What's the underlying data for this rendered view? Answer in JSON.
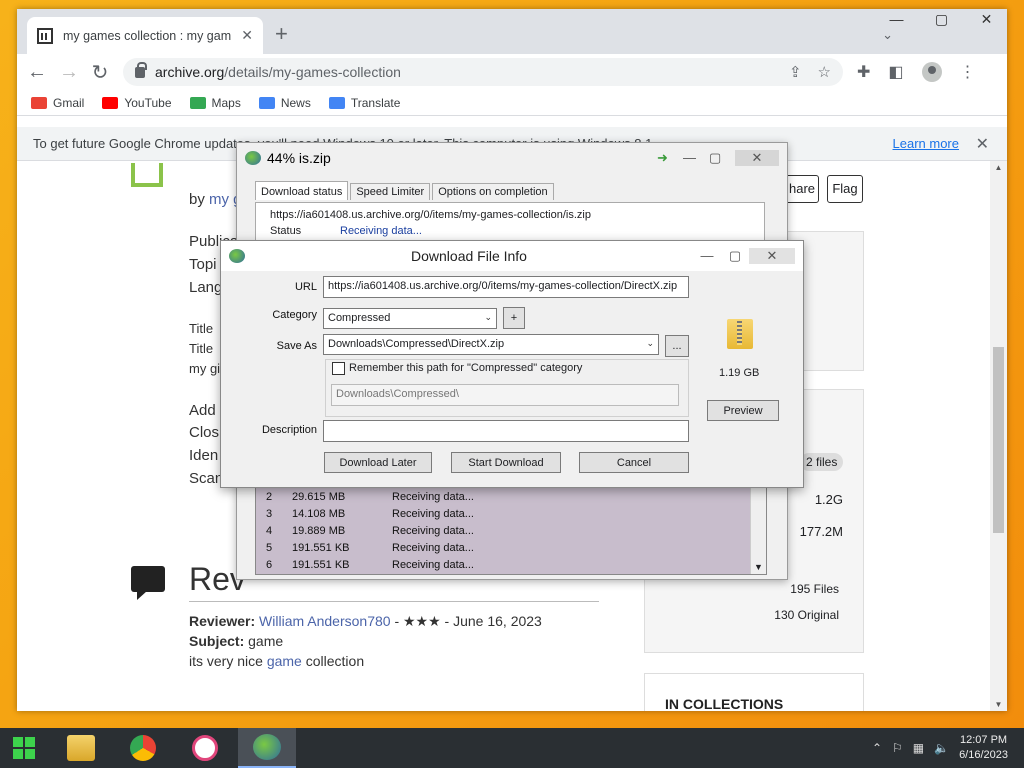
{
  "browser": {
    "tab_title": "my games collection : my games",
    "new_tab": "+",
    "url_domain": "archive.org",
    "url_path": "/details/my-games-collection",
    "bookmarks": [
      {
        "label": "Gmail",
        "color": "#ea4335"
      },
      {
        "label": "YouTube",
        "color": "#ff0000"
      },
      {
        "label": "Maps",
        "color": "#34a853"
      },
      {
        "label": "News",
        "color": "#4285f4"
      },
      {
        "label": "Translate",
        "color": "#4285f4"
      }
    ],
    "infobar_text": "To get future Google Chrome updates, you'll need Windows 10 or later. This computer is using Windows 8.1.",
    "learn_more": "Learn more"
  },
  "page": {
    "by": "by",
    "author_partial": "my g",
    "meta_labels": [
      "Publica",
      "Topi",
      "Lang"
    ],
    "titles": [
      "Title",
      "Title",
      "my gi"
    ],
    "misc": [
      "Add",
      "Clos",
      "Iden",
      "Scan"
    ],
    "share": "hare",
    "flag": "Flag",
    "files_badge": "2 files",
    "size1": "1.2G",
    "size2": "177.2M",
    "files_count": "195 Files",
    "original_count": "130 Original",
    "reviews_heading": "Rev",
    "reviewer_label": "Reviewer:",
    "reviewer_name": "William Anderson780",
    "reviewer_rest": " - ★★★ - June 16, 2023",
    "subject_label": "Subject:",
    "subject_value": "game",
    "review_body_1": "its very nice ",
    "review_link": "game",
    "review_body_2": " collection",
    "in_collections": "IN COLLECTIONS"
  },
  "downloader": {
    "title": "44% is.zip",
    "tabs": [
      "Download status",
      "Speed Limiter",
      "Options on completion"
    ],
    "url": "https://ia601408.us.archive.org/0/items/my-games-collection/is.zip",
    "status_label": "Status",
    "status_value": "Receiving data...",
    "connections": [
      {
        "n": "2",
        "size": "29.615 MB",
        "status": "Receiving data..."
      },
      {
        "n": "3",
        "size": "14.108 MB",
        "status": "Receiving data..."
      },
      {
        "n": "4",
        "size": "19.889 MB",
        "status": "Receiving data..."
      },
      {
        "n": "5",
        "size": "191.551 KB",
        "status": "Receiving data..."
      },
      {
        "n": "6",
        "size": "191.551 KB",
        "status": "Receiving data..."
      }
    ]
  },
  "dfi": {
    "title": "Download File Info",
    "url_label": "URL",
    "url_value": "https://ia601408.us.archive.org/0/items/my-games-collection/DirectX.zip",
    "category_label": "Category",
    "category_value": "Compressed",
    "add_btn": "+",
    "saveas_label": "Save As",
    "saveas_value": "Downloads\\Compressed\\DirectX.zip",
    "browse_btn": "...",
    "remember_label": "Remember this path for \"Compressed\" category",
    "remember_path": "Downloads\\Compressed\\",
    "description_label": "Description",
    "description_value": "",
    "file_size": "1.19  GB",
    "preview_btn": "Preview",
    "download_later": "Download Later",
    "start_download": "Start Download",
    "cancel": "Cancel"
  },
  "taskbar": {
    "time": "12:07 PM",
    "date": "6/16/2023"
  }
}
